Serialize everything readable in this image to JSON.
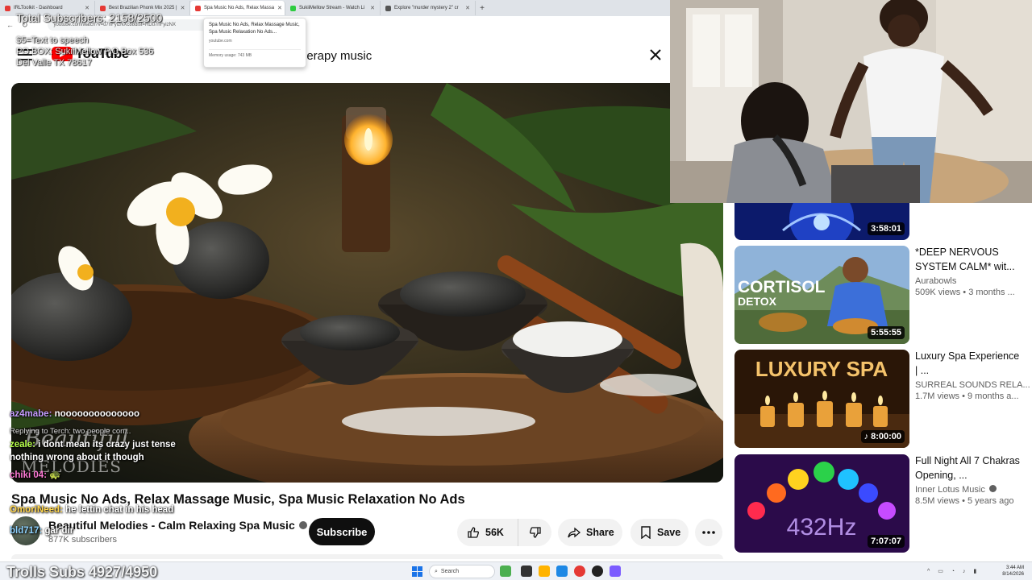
{
  "browser": {
    "tabs": [
      {
        "label": "IRLToolkit - Dashboard",
        "color": "#e53935"
      },
      {
        "label": "Best Brazilian Phonk Mix 2025 |",
        "color": "#e53935"
      },
      {
        "label": "Spa Music No Ads, Relax Massa",
        "color": "#e53935"
      },
      {
        "label": "SukiiMellow Stream - Watch Li",
        "color": "#2ecc40"
      },
      {
        "label": "Explore \"murder mystery 2\" cr",
        "color": "#555555"
      }
    ],
    "url": "youtube.com/watch?v=u7nFyizNXc88dist=RDu7nFyizNX",
    "tooltip": {
      "title": "Spa Music No Ads, Relax Massage Music, Spa Music Relaxation No Ads...",
      "domain": "youtube.com",
      "memory": "Memory usage: 743 MB"
    }
  },
  "stream_overlay": {
    "subs_goal": "Total Subscribers: 2158/2500",
    "tts": "$5=Text to speech",
    "pobox": "PO BOX: SukiiMellow P.O Box 536",
    "address": "Del Valle TX 78617",
    "trolls": "Trolls Subs 4927/4950"
  },
  "youtube": {
    "logo": "YouTube",
    "search_query": "herapy music",
    "video": {
      "title": "Spa Music No Ads, Relax Massage Music, Spa Music Relaxation No Ads",
      "watermark_top": "Beautiful",
      "watermark_bottom": "MELODIES",
      "channel": "Beautiful Melodies - Calm Relaxing Spa Music",
      "subscribers": "877K subscribers",
      "subscribe_label": "Subscribe",
      "likes": "56K",
      "share_label": "Share",
      "save_label": "Save"
    },
    "recommendations": [
      {
        "title": "",
        "channel": "",
        "meta": "",
        "duration": "3:58:01",
        "thumb": "chakra-blue"
      },
      {
        "title": "*DEEP NERVOUS SYSTEM CALM* wit...",
        "channel": "Aurabowls",
        "meta": "509K views • 3 months ...",
        "duration": "5:55:55",
        "thumb": "cortisol",
        "thumb_text_1": "CORTISOL",
        "thumb_text_2": "DETOX"
      },
      {
        "title": "Luxury Spa Experience | ...",
        "channel": "SURREAL SOUNDS RELA...",
        "meta": "1.7M views • 9 months a...",
        "duration": "8:00:00",
        "thumb": "luxury",
        "thumb_text_1": "LUXURY SPA",
        "playlist_icon": true
      },
      {
        "title": "Full Night All 7 Chakras Opening, ...",
        "channel": "Inner Lotus Music",
        "verified": true,
        "meta": "8.5M views • 5 years ago",
        "duration": "7:07:07",
        "thumb": "chakras",
        "thumb_text_1": "432Hz"
      }
    ]
  },
  "chat": [
    {
      "user": "az4mabe:",
      "text": "noooooooooooooo",
      "color_class": "u1"
    },
    {
      "reply": "Replying to Terch: two people con..."
    },
    {
      "user": "zeale:",
      "text": "i dont mean its crazy just tense nothing wrong about it though",
      "color_class": "u2"
    },
    {
      "user": "chiki 04:",
      "text": "🐢",
      "color_class": "u3"
    },
    {
      "user": "OmoriNeed:",
      "text": "he lettin chat in his head",
      "color_class": "u4"
    },
    {
      "user": "bld717:",
      "text": "gar dir",
      "color_class": "u5"
    }
  ],
  "taskbar": {
    "search_placeholder": "Search",
    "time": "3:44 AM",
    "date": "8/14/2026"
  }
}
